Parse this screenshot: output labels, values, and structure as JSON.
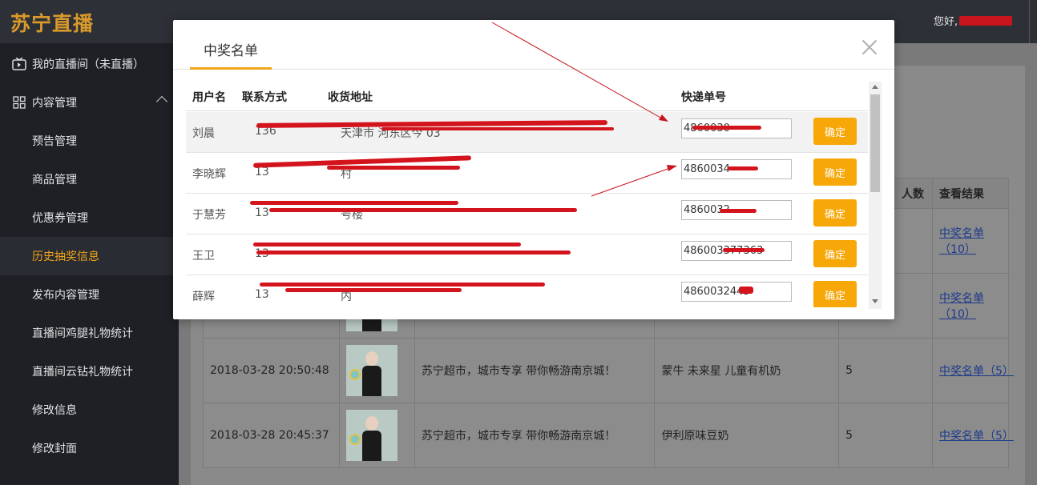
{
  "app": {
    "logo": "苏宁直播",
    "greeting": "您好,"
  },
  "sidebar": {
    "items": [
      {
        "label": "我的直播间（未直播）",
        "icon": "tv-icon",
        "level": "top"
      },
      {
        "label": "内容管理",
        "icon": "grid-icon",
        "level": "top",
        "expanded": true
      },
      {
        "label": "预告管理",
        "level": "sub"
      },
      {
        "label": "商品管理",
        "level": "sub"
      },
      {
        "label": "优惠券管理",
        "level": "sub"
      },
      {
        "label": "历史抽奖信息",
        "level": "sub",
        "active": true
      },
      {
        "label": "发布内容管理",
        "level": "sub"
      },
      {
        "label": "直播间鸡腿礼物统计",
        "level": "sub"
      },
      {
        "label": "直播间云钻礼物统计",
        "level": "sub"
      },
      {
        "label": "修改信息",
        "level": "sub"
      },
      {
        "label": "修改封面",
        "level": "sub"
      }
    ]
  },
  "background_table": {
    "headers": {
      "count": "人数",
      "result": "查看结果"
    },
    "rows": [
      {
        "time": "",
        "title": "",
        "prize": "",
        "count": "",
        "result": "中奖名单（10）"
      },
      {
        "time": "",
        "title": "",
        "prize": "",
        "count": "",
        "result": "中奖名单（10）"
      },
      {
        "time": "2018-03-28 20:50:48",
        "title": "苏宁超市，城市专享 带你畅游南京城！",
        "prize": "蒙牛 未来星 儿童有机奶",
        "count": "5",
        "result": "中奖名单（5）"
      },
      {
        "time": "2018-03-28 20:45:37",
        "title": "苏宁超市，城市专享 带你畅游南京城！",
        "prize": "伊利原味豆奶",
        "count": "5",
        "result": "中奖名单（5）"
      }
    ]
  },
  "modal": {
    "title": "中奖名单",
    "columns": {
      "user": "用户名",
      "phone": "联系方式",
      "address": "收货地址",
      "express": "快递单号"
    },
    "confirm_label": "确定",
    "rows": [
      {
        "user": "刘晨",
        "phone": "136",
        "address": "天津市 河东区今  03",
        "express": "4860030"
      },
      {
        "user": "李晓辉",
        "phone": "13",
        "address": "村",
        "express": "4860034"
      },
      {
        "user": "于慧芳",
        "phone": "13",
        "address": "号楼",
        "express": "4860032"
      },
      {
        "user": "王卫",
        "phone": "13",
        "address": "",
        "express": "486003377363"
      },
      {
        "user": "薛辉",
        "phone": "13",
        "address": "内",
        "express": "4860032445"
      }
    ]
  },
  "colors": {
    "accent": "#f0a51a",
    "redaction": "#d4141c",
    "confirm_button": "#f7a708",
    "link": "#1b3a8c"
  }
}
